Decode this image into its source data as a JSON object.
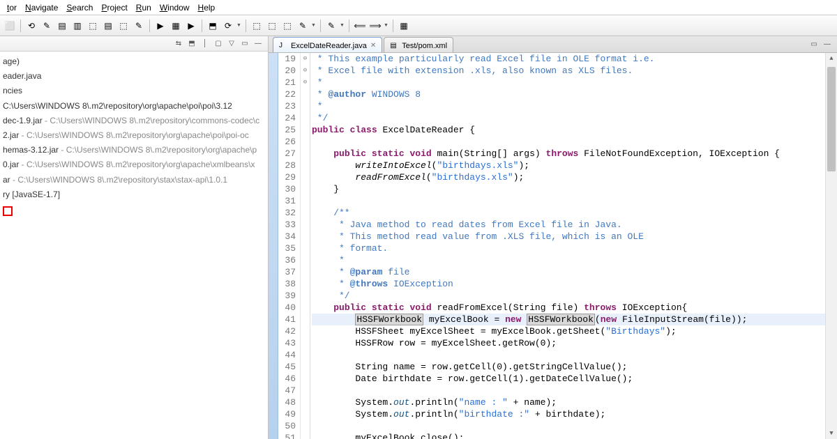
{
  "menu": [
    "tor",
    "Navigate",
    "Search",
    "Project",
    "Run",
    "Window",
    "Help"
  ],
  "sidebar_buttons": [
    "⇆",
    "⬒",
    "│",
    "▢",
    "▽",
    "▭",
    "—"
  ],
  "tree": [
    {
      "text": "age)"
    },
    {
      "text": "eader.java"
    },
    {
      "text": "ncies"
    },
    {
      "text": "C:\\Users\\WINDOWS 8\\.m2\\repository\\org\\apache\\poi\\poi\\3.12",
      "gray": false
    },
    {
      "text": "dec-1.9.jar",
      "path": " - C:\\Users\\WINDOWS 8\\.m2\\repository\\commons-codec\\c"
    },
    {
      "text": "2.jar",
      "path": " - C:\\Users\\WINDOWS 8\\.m2\\repository\\org\\apache\\poi\\poi-oc"
    },
    {
      "text": "hemas-3.12.jar",
      "path": " - C:\\Users\\WINDOWS 8\\.m2\\repository\\org\\apache\\p"
    },
    {
      "text": "0.jar",
      "path": " - C:\\Users\\WINDOWS 8\\.m2\\repository\\org\\apache\\xmlbeans\\x"
    },
    {
      "text": "ar",
      "path": " - C:\\Users\\WINDOWS 8\\.m2\\repository\\stax\\stax-api\\1.0.1"
    },
    {
      "text": "ry [JavaSE-1.7]"
    }
  ],
  "tabs": [
    {
      "label": "Test/pom.xml",
      "active": false,
      "icon": "▤"
    },
    {
      "label": "ExcelDateReader.java",
      "active": true,
      "icon": "J",
      "close": "✕"
    }
  ],
  "code": [
    {
      "n": 19,
      "fold": "",
      "hl": false,
      "html": " * This example particularly read Excel file in OLE format i.e.",
      "cls": "cm"
    },
    {
      "n": 20,
      "fold": "",
      "hl": false,
      "html": " * Excel file with extension .xls, also known as XLS files.",
      "cls": "cm"
    },
    {
      "n": 21,
      "fold": "",
      "hl": false,
      "html": " *",
      "cls": "cm"
    },
    {
      "n": 22,
      "fold": "",
      "hl": false,
      "html": " * @author WINDOWS 8",
      "cls": "cm",
      "tag": "@author"
    },
    {
      "n": 23,
      "fold": "",
      "hl": false,
      "html": " *",
      "cls": "cm"
    },
    {
      "n": 24,
      "fold": "",
      "hl": false,
      "html": " */",
      "cls": "cm"
    },
    {
      "n": 25,
      "fold": "",
      "hl": false,
      "raw": "<span class='kw'>public</span> <span class='kw'>class</span> ExcelDateReader {"
    },
    {
      "n": 26,
      "fold": "",
      "hl": false,
      "raw": ""
    },
    {
      "n": 27,
      "fold": "⊖",
      "hl": false,
      "raw": "    <span class='kw'>public</span> <span class='kw'>static</span> <span class='kw'>void</span> main(String[] args) <span class='kw'>throws</span> FileNotFoundException, IOException {"
    },
    {
      "n": 28,
      "fold": "",
      "hl": false,
      "raw": "        <span class='itc'>writeIntoExcel</span>(<span class='str'>\"birthdays.xls\"</span>);"
    },
    {
      "n": 29,
      "fold": "",
      "hl": false,
      "raw": "        <span class='itc'>readFromExcel</span>(<span class='str'>\"birthdays.xls\"</span>);"
    },
    {
      "n": 30,
      "fold": "",
      "hl": false,
      "raw": "    }"
    },
    {
      "n": 31,
      "fold": "",
      "hl": false,
      "raw": ""
    },
    {
      "n": 32,
      "fold": "⊖",
      "hl": false,
      "html": "    /**",
      "cls": "cm"
    },
    {
      "n": 33,
      "fold": "",
      "hl": false,
      "html": "     * Java method to read dates from Excel file in Java.",
      "cls": "cm"
    },
    {
      "n": 34,
      "fold": "",
      "hl": false,
      "html": "     * This method read value from .XLS file, which is an OLE",
      "cls": "cm"
    },
    {
      "n": 35,
      "fold": "",
      "hl": false,
      "html": "     * format.",
      "cls": "cm"
    },
    {
      "n": 36,
      "fold": "",
      "hl": false,
      "html": "     *",
      "cls": "cm"
    },
    {
      "n": 37,
      "fold": "",
      "hl": false,
      "html": "     * @param file",
      "cls": "cm",
      "tag": "@param"
    },
    {
      "n": 38,
      "fold": "",
      "hl": false,
      "html": "     * @throws IOException",
      "cls": "cm",
      "tag": "@throws"
    },
    {
      "n": 39,
      "fold": "",
      "hl": false,
      "html": "     */",
      "cls": "cm"
    },
    {
      "n": 40,
      "fold": "⊖",
      "hl": false,
      "raw": "    <span class='kw'>public</span> <span class='kw'>static</span> <span class='kw'>void</span> readFromExcel(String file) <span class='kw'>throws</span> IOException{"
    },
    {
      "n": 41,
      "fold": "",
      "hl": true,
      "raw": "        <span class='boxhl'>HSSFWorkbook</span> myExcelBook = <span class='kw'>new</span> <span class='boxhl'>HSSFWorkbook</span>(<span class='kw'>new</span> FileInputStream(file));"
    },
    {
      "n": 42,
      "fold": "",
      "hl": false,
      "raw": "        HSSFSheet myExcelSheet = myExcelBook.getSheet(<span class='str'>\"Birthdays\"</span>);"
    },
    {
      "n": 43,
      "fold": "",
      "hl": false,
      "raw": "        HSSFRow row = myExcelSheet.getRow(0);"
    },
    {
      "n": 44,
      "fold": "",
      "hl": false,
      "raw": ""
    },
    {
      "n": 45,
      "fold": "",
      "hl": false,
      "raw": "        String name = row.getCell(0).getStringCellValue();"
    },
    {
      "n": 46,
      "fold": "",
      "hl": false,
      "raw": "        Date birthdate = row.getCell(1).getDateCellValue();"
    },
    {
      "n": 47,
      "fold": "",
      "hl": false,
      "raw": ""
    },
    {
      "n": 48,
      "fold": "",
      "hl": false,
      "raw": "        System.<span class='stat'>out</span>.println(<span class='str'>\"name : \"</span> + name);"
    },
    {
      "n": 49,
      "fold": "",
      "hl": false,
      "raw": "        System.<span class='stat'>out</span>.println(<span class='str'>\"birthdate :\"</span> + birthdate);"
    },
    {
      "n": 50,
      "fold": "",
      "hl": false,
      "raw": ""
    },
    {
      "n": 51,
      "fold": "",
      "hl": false,
      "raw": "        myExcelBook.close();"
    }
  ],
  "tab_controls": [
    "▭",
    "—"
  ],
  "toolbar_icons": [
    "⬜",
    "│",
    "⟲",
    "✎",
    "▤",
    "▥",
    "⬚",
    "▤",
    "⬚",
    "✎",
    "│",
    "▶",
    "▦",
    "▶",
    "│",
    "⬒",
    "⟳",
    "▼",
    "│",
    "⬚",
    "⬚",
    "⬚",
    "✎",
    "▼",
    "│",
    "✎",
    "▼",
    "│",
    "⟸",
    "⟹",
    "▼",
    "│",
    "▦"
  ]
}
